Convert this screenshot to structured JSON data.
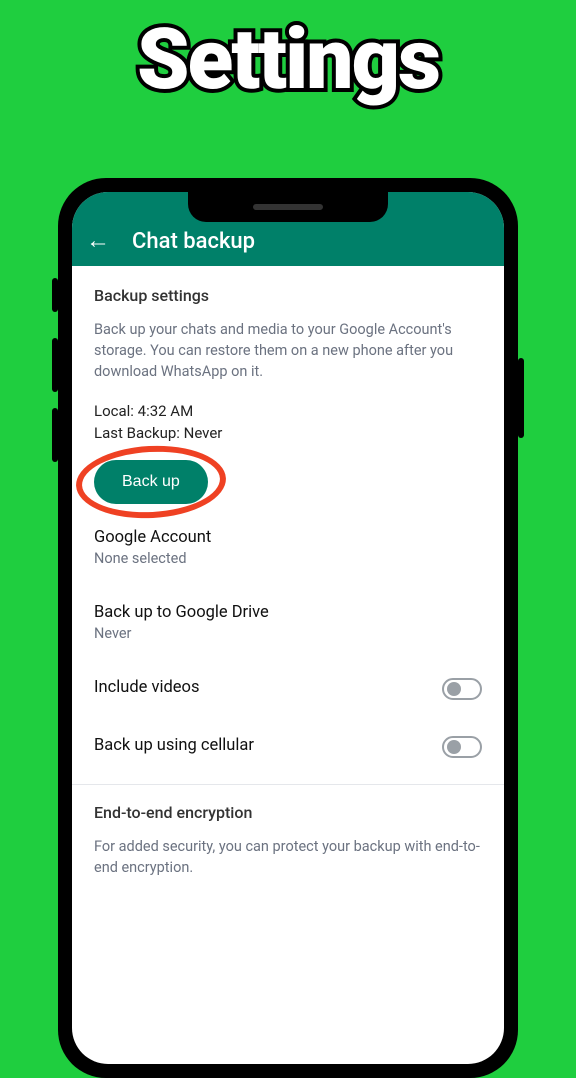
{
  "promo": {
    "title": "Settings"
  },
  "appbar": {
    "title": "Chat backup"
  },
  "backupSection": {
    "heading": "Backup settings",
    "description": "Back up your chats and media to your Google Account's storage. You can restore them on a new phone after you download WhatsApp on it.",
    "localLine": "Local: 4:32 AM",
    "lastBackupLine": "Last Backup: Never",
    "backupButton": "Back up"
  },
  "googleAccount": {
    "label": "Google Account",
    "value": "None selected"
  },
  "driveFreq": {
    "label": "Back up to Google Drive",
    "value": "Never"
  },
  "includeVideos": {
    "label": "Include videos"
  },
  "cellular": {
    "label": "Back up using cellular"
  },
  "encryption": {
    "heading": "End-to-end encryption",
    "description": "For added security, you can protect your backup with end-to-end encryption."
  }
}
